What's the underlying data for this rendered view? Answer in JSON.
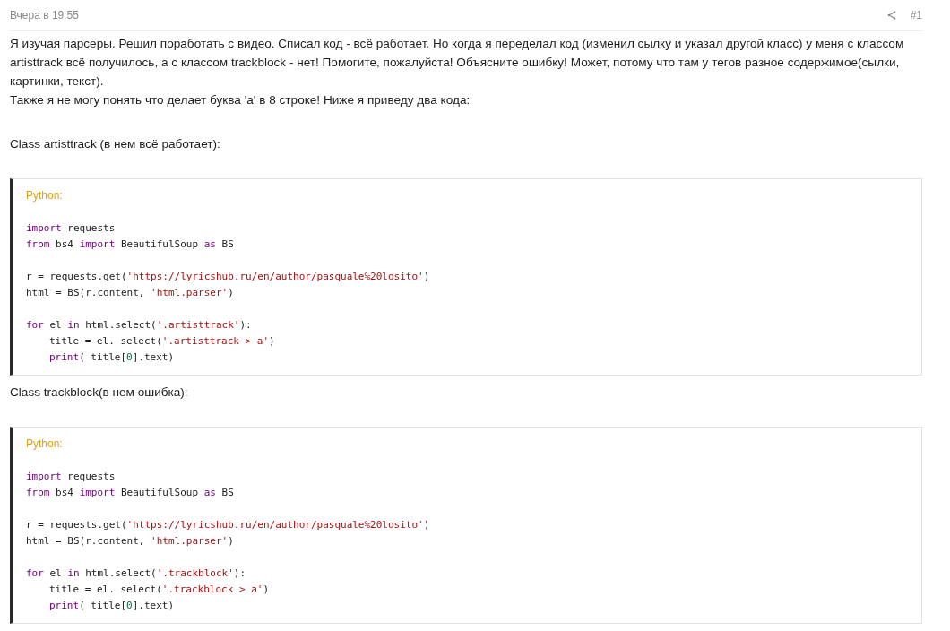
{
  "post": {
    "time": "Вчера в 19:55",
    "number": "#1"
  },
  "body": [
    {
      "kind": "text",
      "lines": [
        "Я изучая парсеры. Решил поработать с видео. Списал код - всё работает. Но когда я переделал код (изменил сылку и указал другой класс) у меня с классом artisttrack всё получилось, а с классом trackblock - нет! Помогите, пожалуйста! Объясните ошибку! Может, потому что там у тегов разное содержимое(сылки, картинки, текст).",
        "Также я не могу понять что делает буква 'а' в 8 строке! Ниже я приведу два кода:"
      ]
    },
    {
      "kind": "heading",
      "text": "Class artisttrack (в нем всё работает):"
    },
    {
      "kind": "code",
      "language": "Python:",
      "groups": [
        [
          {
            "tokens": [
              {
                "text": "import",
                "kind": "keyword"
              },
              {
                "text": " requests",
                "kind": "plain"
              }
            ]
          },
          {
            "tokens": [
              {
                "text": "from",
                "kind": "keyword"
              },
              {
                "text": " bs4 ",
                "kind": "plain"
              },
              {
                "text": "import",
                "kind": "keyword"
              },
              {
                "text": " BeautifulSoup ",
                "kind": "plain"
              },
              {
                "text": "as",
                "kind": "keyword"
              },
              {
                "text": " BS",
                "kind": "plain"
              }
            ]
          }
        ],
        [
          {
            "tokens": [
              {
                "text": "r = requests.get(",
                "kind": "plain"
              },
              {
                "text": "'https://lyricshub.ru/en/author/pasquale%20losito'",
                "kind": "string"
              },
              {
                "text": ")",
                "kind": "plain"
              }
            ]
          },
          {
            "tokens": [
              {
                "text": "html = BS(r.content, ",
                "kind": "plain"
              },
              {
                "text": "'html.parser'",
                "kind": "string"
              },
              {
                "text": ")",
                "kind": "plain"
              }
            ]
          }
        ],
        [
          {
            "tokens": [
              {
                "text": "for",
                "kind": "keyword"
              },
              {
                "text": " el ",
                "kind": "plain"
              },
              {
                "text": "in",
                "kind": "keyword"
              },
              {
                "text": " html.select(",
                "kind": "plain"
              },
              {
                "text": "'.artisttrack'",
                "kind": "string"
              },
              {
                "text": "):",
                "kind": "plain"
              }
            ],
            "children": [
              {
                "tokens": [
                  {
                    "text": "title = el. select(",
                    "kind": "plain"
                  },
                  {
                    "text": "'.artisttrack > a'",
                    "kind": "string"
                  },
                  {
                    "text": ")",
                    "kind": "plain"
                  }
                ]
              },
              {
                "tokens": [
                  {
                    "text": "print",
                    "kind": "keyword"
                  },
                  {
                    "text": "( title[",
                    "kind": "plain"
                  },
                  {
                    "text": "0",
                    "kind": "number"
                  },
                  {
                    "text": "].text)",
                    "kind": "plain"
                  }
                ]
              }
            ]
          }
        ]
      ]
    },
    {
      "kind": "heading",
      "text": "Class trackblock(в нем ошибка):"
    },
    {
      "kind": "code",
      "language": "Python:",
      "groups": [
        [
          {
            "tokens": [
              {
                "text": "import",
                "kind": "keyword"
              },
              {
                "text": " requests",
                "kind": "plain"
              }
            ]
          },
          {
            "tokens": [
              {
                "text": "from",
                "kind": "keyword"
              },
              {
                "text": " bs4 ",
                "kind": "plain"
              },
              {
                "text": "import",
                "kind": "keyword"
              },
              {
                "text": " BeautifulSoup ",
                "kind": "plain"
              },
              {
                "text": "as",
                "kind": "keyword"
              },
              {
                "text": " BS",
                "kind": "plain"
              }
            ]
          }
        ],
        [
          {
            "tokens": [
              {
                "text": "r = requests.get(",
                "kind": "plain"
              },
              {
                "text": "'https://lyricshub.ru/en/author/pasquale%20losito'",
                "kind": "string"
              },
              {
                "text": ")",
                "kind": "plain"
              }
            ]
          },
          {
            "tokens": [
              {
                "text": "html = BS(r.content, ",
                "kind": "plain"
              },
              {
                "text": "'html.parser'",
                "kind": "string"
              },
              {
                "text": ")",
                "kind": "plain"
              }
            ]
          }
        ],
        [
          {
            "tokens": [
              {
                "text": "for",
                "kind": "keyword"
              },
              {
                "text": " el ",
                "kind": "plain"
              },
              {
                "text": "in",
                "kind": "keyword"
              },
              {
                "text": " html.select(",
                "kind": "plain"
              },
              {
                "text": "'.trackblock'",
                "kind": "string"
              },
              {
                "text": "):",
                "kind": "plain"
              }
            ],
            "children": [
              {
                "tokens": [
                  {
                    "text": "title = el. select(",
                    "kind": "plain"
                  },
                  {
                    "text": "'.trackblock > a'",
                    "kind": "string"
                  },
                  {
                    "text": ")",
                    "kind": "plain"
                  }
                ]
              },
              {
                "tokens": [
                  {
                    "text": "print",
                    "kind": "keyword"
                  },
                  {
                    "text": "( title[",
                    "kind": "plain"
                  },
                  {
                    "text": "0",
                    "kind": "number"
                  },
                  {
                    "text": "].text)",
                    "kind": "plain"
                  }
                ]
              }
            ]
          }
        ]
      ]
    }
  ]
}
